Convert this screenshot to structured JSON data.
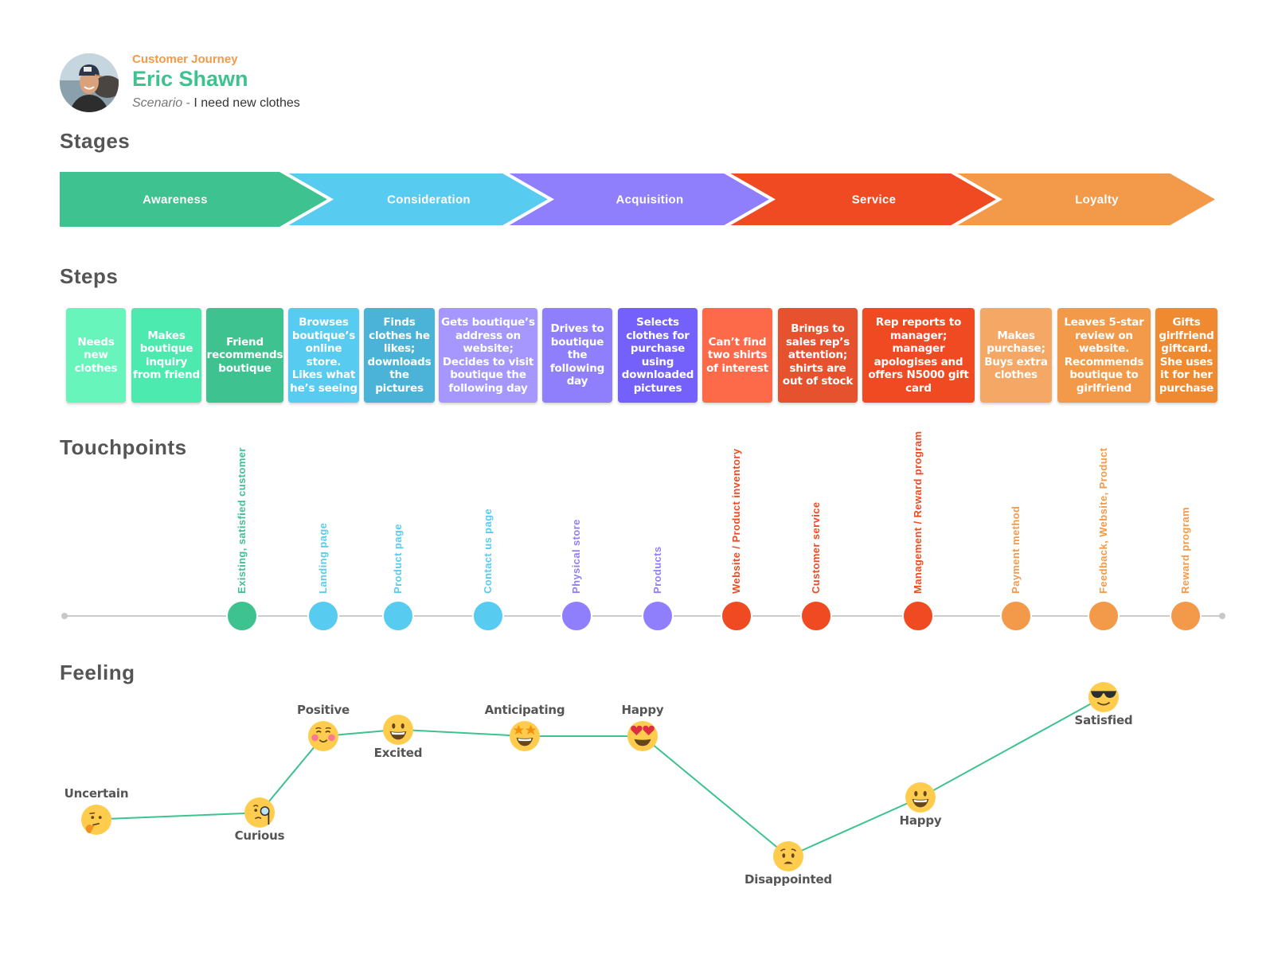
{
  "header": {
    "kicker": "Customer Journey",
    "name": "Eric Shawn",
    "scenario_prefix": "Scenario",
    "scenario_sep": " - ",
    "scenario_text": "I need new clothes"
  },
  "sections": {
    "stages": "Stages",
    "steps": "Steps",
    "touchpoints": "Touchpoints",
    "feeling": "Feeling"
  },
  "colors": {
    "green": "#3ec28f",
    "blue": "#58cbf1",
    "purple": "#8f7ffc",
    "red": "#f04a23",
    "orange": "#f29a4a",
    "line": "#cccccc",
    "feeling_line": "#3ec28f"
  },
  "stages": [
    {
      "label": "Awareness",
      "color": "#3ec28f"
    },
    {
      "label": "Consideration",
      "color": "#58cbf1"
    },
    {
      "label": "Acquisition",
      "color": "#8f7ffc"
    },
    {
      "label": "Service",
      "color": "#f04a23"
    },
    {
      "label": "Loyalty",
      "color": "#f29a4a"
    }
  ],
  "steps": [
    {
      "text": "Needs new clothes",
      "color": "#67f5bc"
    },
    {
      "text": "Makes boutique inquiry from friend",
      "color": "#4deab0"
    },
    {
      "text": "Friend recommends boutique",
      "color": "#3ec28f"
    },
    {
      "text": "Browses boutique’s online store. Likes what he’s seeing",
      "color": "#58cbf1"
    },
    {
      "text": "Finds clothes he likes; downloads the pictures",
      "color": "#4ab3d7"
    },
    {
      "text": "Gets boutique’s address on website; Decides to visit boutique the following day",
      "color": "#a597fd"
    },
    {
      "text": "Drives to boutique the following day",
      "color": "#8f7ffc"
    },
    {
      "text": "Selects clothes for purchase using downloaded pictures",
      "color": "#7460fb"
    },
    {
      "text": "Can’t find two shirts of interest",
      "color": "#fd6a4a"
    },
    {
      "text": "Brings to sales rep’s attention; shirts are out of stock",
      "color": "#e6512e"
    },
    {
      "text": "Rep reports to manager; manager apologises and offers N5000 gift card",
      "color": "#f04a23"
    },
    {
      "text": "Makes purchase; Buys extra clothes",
      "color": "#f5a865"
    },
    {
      "text": "Leaves 5-star review on website. Recommends boutique to girlfriend",
      "color": "#f29a4a"
    },
    {
      "text": "Gifts girlfriend giftcard. She uses it for her purchase",
      "color": "#ef8a30"
    }
  ],
  "touchpoints": [
    {
      "label": "Existing, satisfied customer",
      "color": "#3ec28f"
    },
    {
      "label": "Landing page",
      "color": "#58cbf1"
    },
    {
      "label": "Product page",
      "color": "#58cbf1"
    },
    {
      "label": "Contact us  page",
      "color": "#58cbf1"
    },
    {
      "label": "Physical store",
      "color": "#8f7ffc"
    },
    {
      "label": "Products",
      "color": "#8f7ffc"
    },
    {
      "label": "Website / Product inventory",
      "color": "#f04a23"
    },
    {
      "label": "Customer service",
      "color": "#f04a23"
    },
    {
      "label": "Management / Reward program",
      "color": "#f04a23"
    },
    {
      "label": "Payment method",
      "color": "#f29a4a"
    },
    {
      "label": "Feedback, Website, Product",
      "color": "#f29a4a"
    },
    {
      "label": "Reward program",
      "color": "#f29a4a"
    }
  ],
  "feelings": [
    {
      "label": "Uncertain",
      "emoji": "thinking-face",
      "label_pos": "above"
    },
    {
      "label": "Curious",
      "emoji": "face-with-monocle",
      "label_pos": "below"
    },
    {
      "label": "Positive",
      "emoji": "smiling-face-blushing",
      "label_pos": "above"
    },
    {
      "label": "Excited",
      "emoji": "grinning-face",
      "label_pos": "below"
    },
    {
      "label": "Anticipating",
      "emoji": "star-struck",
      "label_pos": "above"
    },
    {
      "label": "Happy",
      "emoji": "heart-eyes",
      "label_pos": "above"
    },
    {
      "label": "Disappointed",
      "emoji": "worried-face",
      "label_pos": "below"
    },
    {
      "label": "Happy",
      "emoji": "grinning-face",
      "label_pos": "below"
    },
    {
      "label": "Satisfied",
      "emoji": "sunglasses-face",
      "label_pos": "below"
    }
  ],
  "chart_data": {
    "type": "line",
    "title": "Feeling",
    "categories": [
      "Uncertain",
      "Curious",
      "Positive",
      "Excited",
      "Anticipating",
      "Happy",
      "Disappointed",
      "Happy",
      "Satisfied"
    ],
    "values": [
      2.2,
      2.5,
      6.0,
      6.3,
      6.0,
      6.0,
      0.5,
      3.2,
      7.8
    ],
    "ylim": [
      0,
      8
    ],
    "xlabel": "",
    "ylabel": "",
    "grid": false
  }
}
